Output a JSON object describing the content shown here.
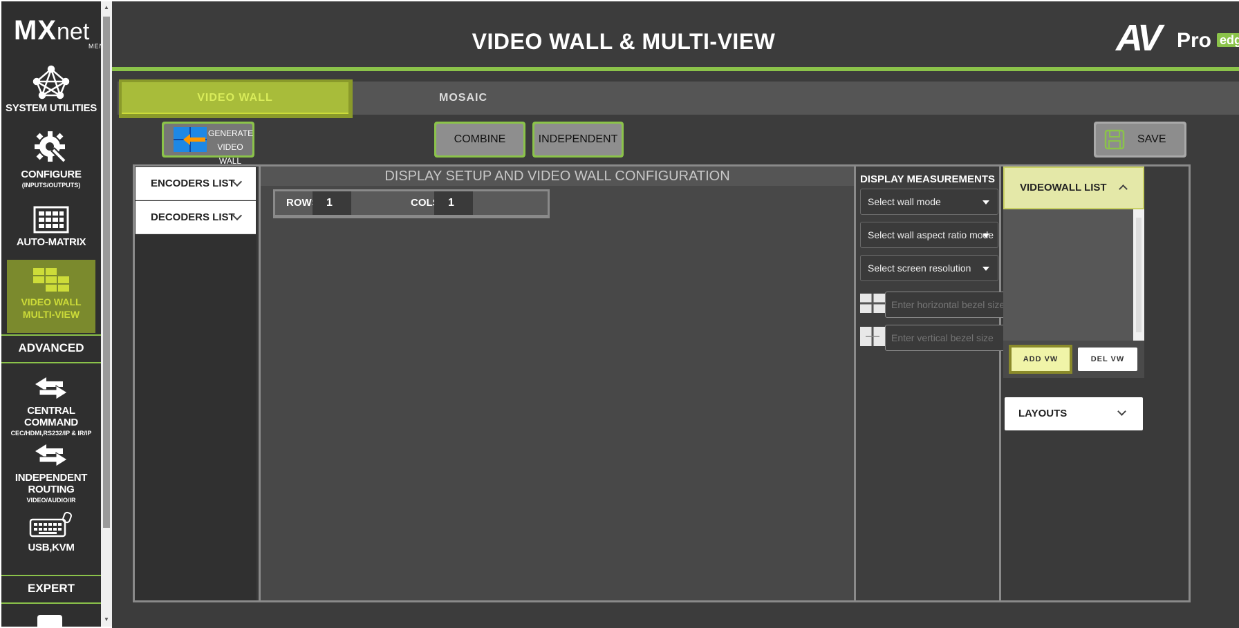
{
  "sidebar": {
    "logo_main": "MX",
    "logo_net": "net",
    "logo_sub": "MENTOR",
    "items": [
      {
        "label": "SYSTEM UTILITIES",
        "sub": ""
      },
      {
        "label": "CONFIGURE",
        "sub": "(INPUTS/OUTPUTS)"
      },
      {
        "label": "AUTO-MATRIX",
        "sub": ""
      },
      {
        "label": "VIDEO WALL",
        "label2": "MULTI-VIEW",
        "selected": true
      },
      {
        "label": "CENTRAL COMMAND",
        "sub": "CEC/HDMI,RS232/IP & IR/IP"
      },
      {
        "label": "INDEPENDENT ROUTING",
        "sub": "VIDEO/AUDIO/IR"
      },
      {
        "label": "USB,KVM",
        "sub": ""
      }
    ],
    "section_advanced": "ADVANCED",
    "section_expert": "EXPERT"
  },
  "header": {
    "title": "VIDEO WALL & MULTI-VIEW",
    "brand_av": "AV",
    "brand_pro": "Pro",
    "brand_edge": "edge"
  },
  "tabs": {
    "video_wall": "VIDEO WALL",
    "mosaic": "MOSAIC"
  },
  "toolbar": {
    "generate_line1": "GENERATE",
    "generate_line2": "VIDEO WALL",
    "combine": "COMBINE",
    "independent": "INDEPENDENT",
    "save": "SAVE"
  },
  "left_panel": {
    "encoders": "ENCODERS LIST",
    "decoders": "DECODERS LIST"
  },
  "center": {
    "title": "DISPLAY SETUP AND VIDEO WALL CONFIGURATION",
    "rows_label": "ROWS",
    "rows_value": "1",
    "cols_label": "COLS",
    "cols_value": "1"
  },
  "measurements": {
    "title": "DISPLAY MEASUREMENTS",
    "wall_mode": "Select wall mode",
    "aspect_mode": "Select wall aspect ratio mode",
    "resolution": "Select screen resolution",
    "h_bezel_placeholder": "Enter horizontal bezel size",
    "v_bezel_placeholder": "Enter vertical bezel size"
  },
  "videowall_list": {
    "title": "VIDEOWALL LIST",
    "add": "ADD VW",
    "del": "DEL VW",
    "layouts": "LAYOUTS"
  },
  "colors": {
    "accent_green": "#8bc34a",
    "selected_olive": "#7b8a2d",
    "background": "#3c3c3c"
  }
}
